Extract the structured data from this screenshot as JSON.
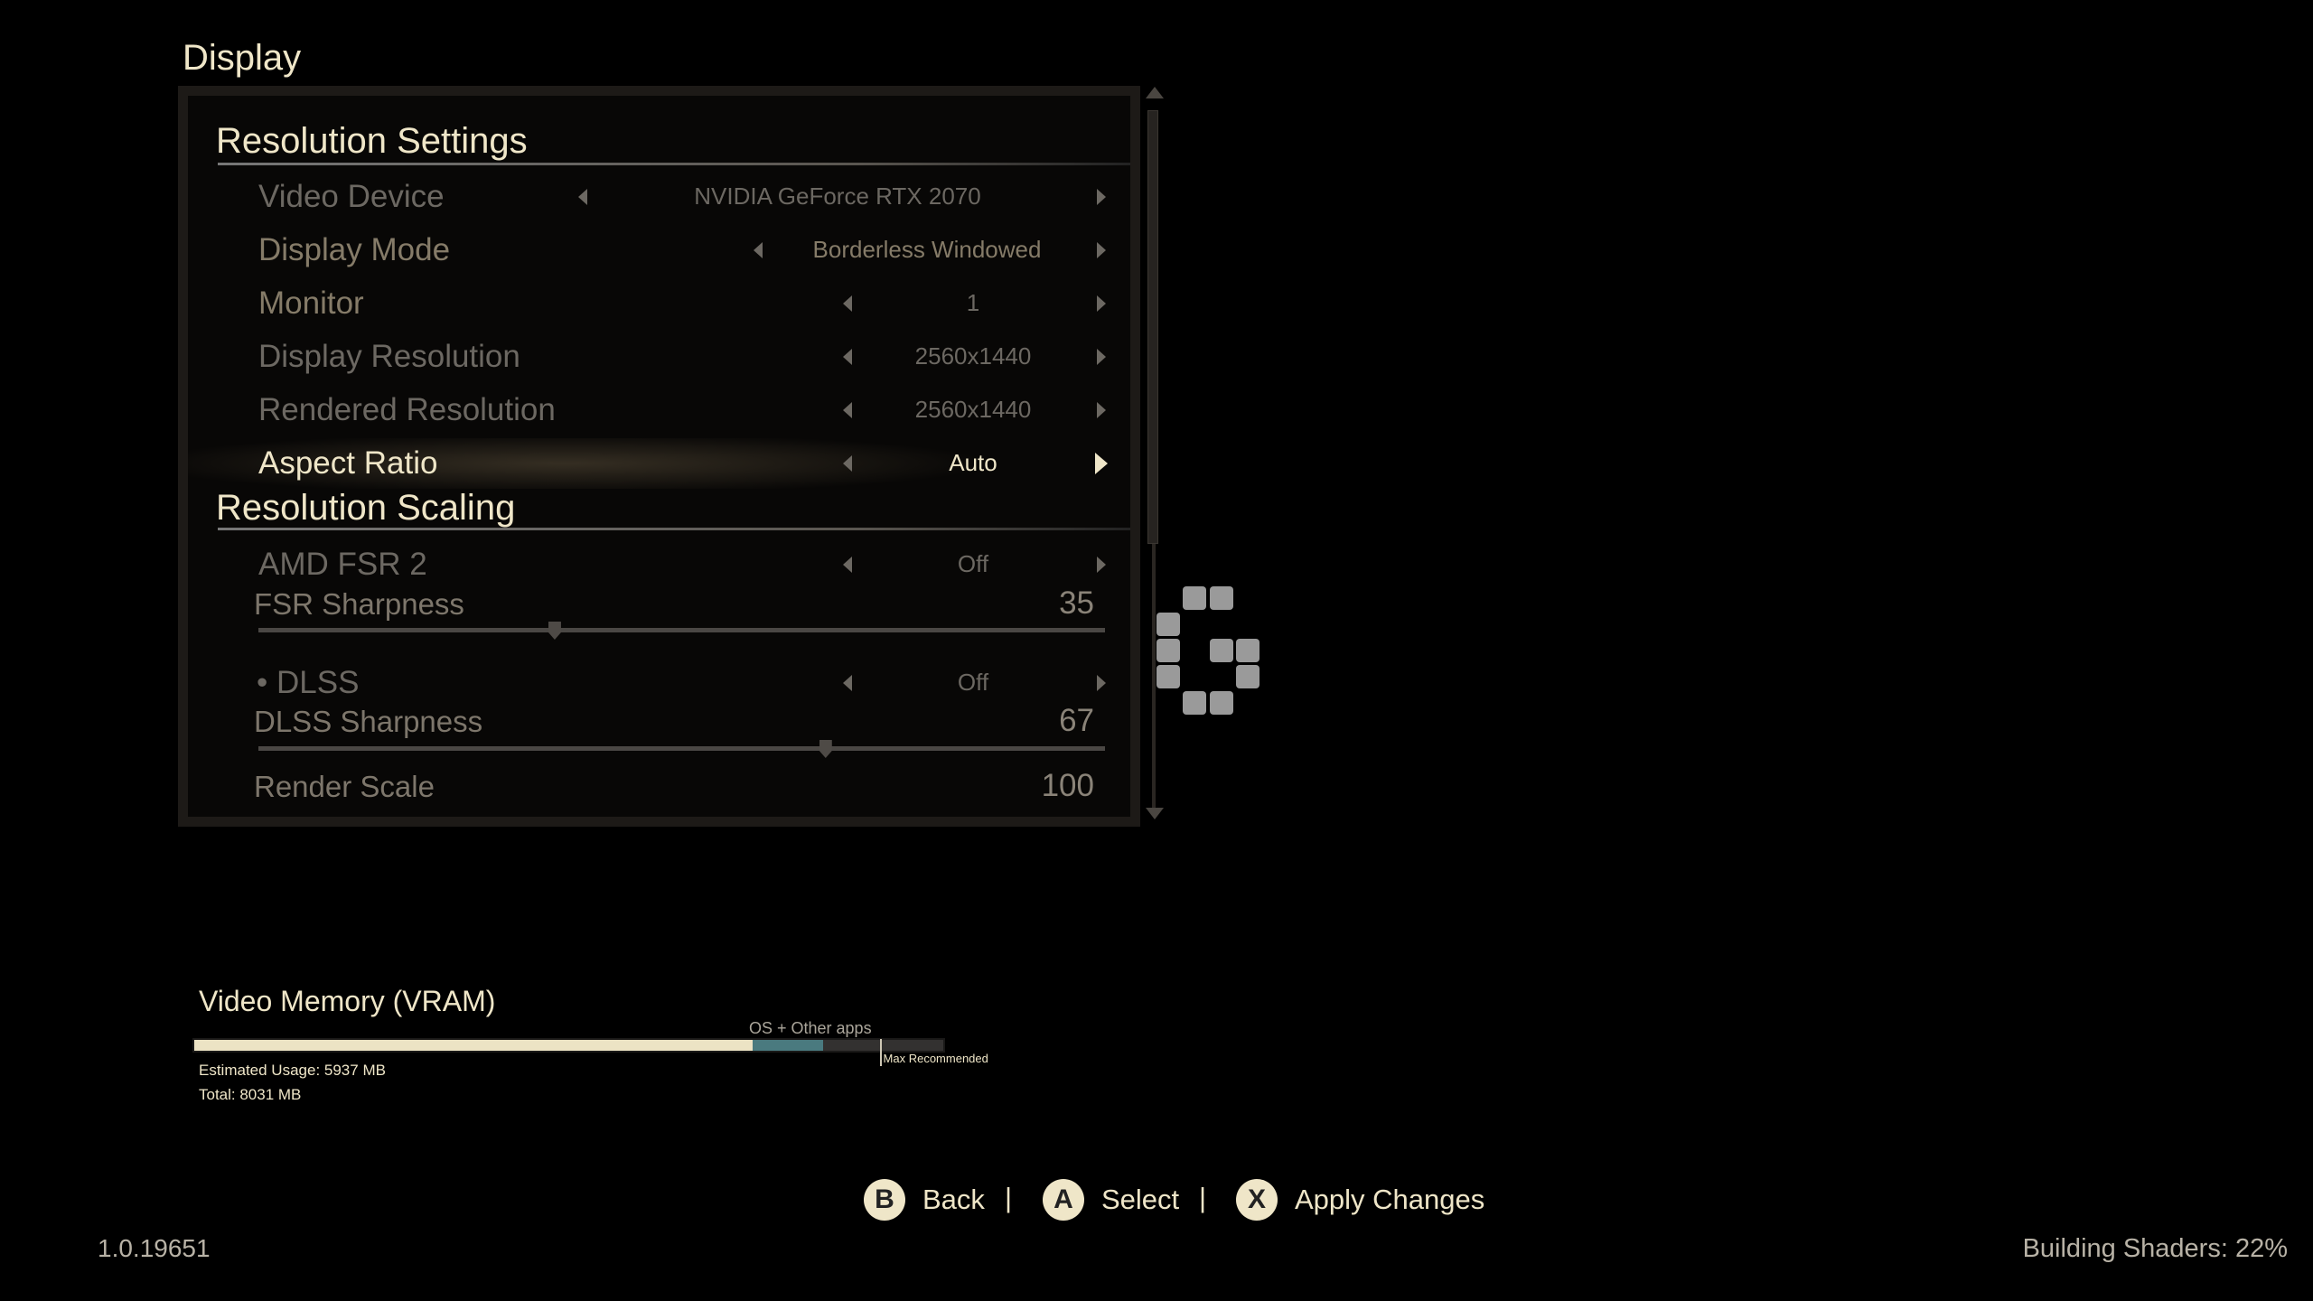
{
  "title": "Display",
  "sections": [
    {
      "header": "Resolution Settings",
      "rows": [
        {
          "label": "Video Device",
          "value": "NVIDIA GeForce RTX 2070"
        },
        {
          "label": "Display Mode",
          "value": "Borderless Windowed"
        },
        {
          "label": "Monitor",
          "value": "1"
        },
        {
          "label": "Display Resolution",
          "value": "2560x1440"
        },
        {
          "label": "Rendered Resolution",
          "value": "2560x1440"
        },
        {
          "label": "Aspect Ratio",
          "value": "Auto",
          "selected": true
        }
      ]
    },
    {
      "header": "Resolution Scaling",
      "rows": [
        {
          "label": "AMD FSR 2",
          "value": "Off"
        },
        {
          "label": "FSR Sharpness",
          "value": "35",
          "slider": 35
        },
        {
          "label": "DLSS",
          "value": "Off",
          "bullet": "•"
        },
        {
          "label": "DLSS Sharpness",
          "value": "67",
          "slider": 67
        },
        {
          "label": "Render Scale",
          "value": "100"
        }
      ]
    }
  ],
  "vram": {
    "title": "Video Memory (VRAM)",
    "os_label": "OS + Other apps",
    "max_label": "Max Recommended",
    "estimated": "Estimated Usage: 5937 MB",
    "total": "Total: 8031 MB",
    "usage_fraction": 0.745,
    "os_fraction": 0.094,
    "max_fraction": 0.915,
    "colors": {
      "usage": "#ece3c4",
      "os": "#4a7a7f",
      "empty": "#333130"
    }
  },
  "footer": {
    "buttons": [
      {
        "key": "B",
        "label": "Back"
      },
      {
        "key": "A",
        "label": "Select"
      },
      {
        "key": "X",
        "label": "Apply Changes"
      }
    ],
    "separator": "|",
    "version": "1.0.19651",
    "status": "Building Shaders: 22%"
  },
  "loading_icon": "spinner-grid-icon"
}
